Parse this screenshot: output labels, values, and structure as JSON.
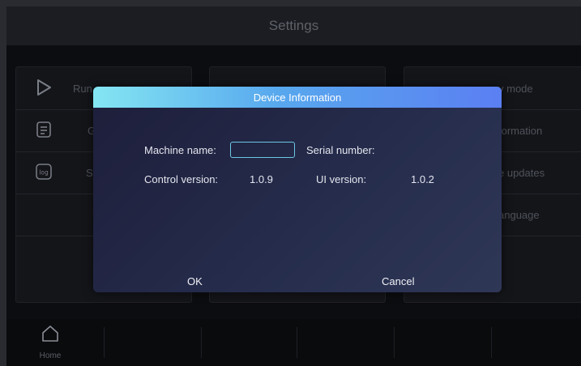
{
  "header": {
    "title": "Settings"
  },
  "panels": {
    "left": [
      {
        "icon": "play-icon",
        "label": "Run"
      },
      {
        "icon": "document-icon",
        "label": "G"
      },
      {
        "icon": "log-icon",
        "label": "Sy"
      }
    ],
    "right": [
      {
        "label": "y mode"
      },
      {
        "label": "formation"
      },
      {
        "label": "e updates"
      },
      {
        "label": "anguage"
      }
    ]
  },
  "dialog": {
    "title": "Device Information",
    "machine_name_label": "Machine name:",
    "machine_name_value": "",
    "serial_number_label": "Serial number:",
    "control_version_label": "Control version:",
    "control_version_value": "1.0.9",
    "ui_version_label": "UI version:",
    "ui_version_value": "1.0.2",
    "ok_label": "OK",
    "cancel_label": "Cancel"
  },
  "bottom_nav": {
    "home_label": "Home",
    "home_icon": "home-icon"
  }
}
